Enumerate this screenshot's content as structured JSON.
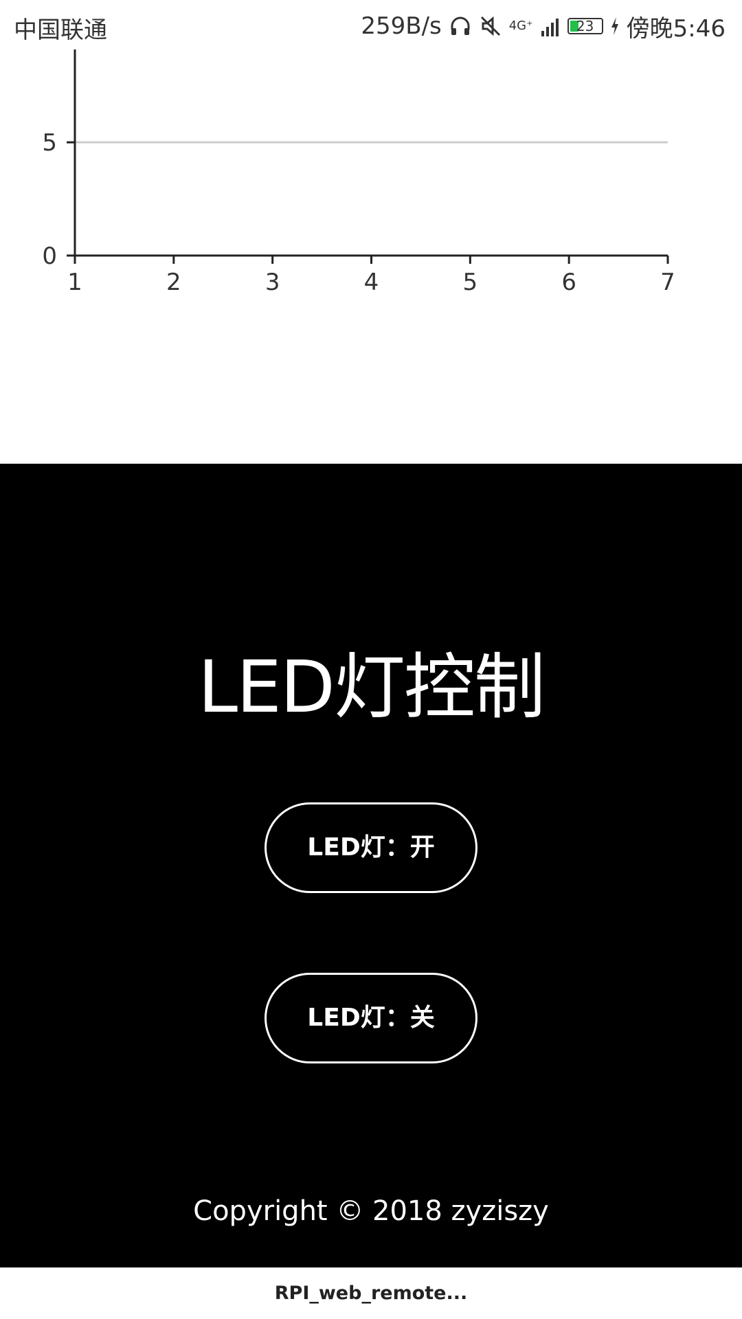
{
  "status_bar": {
    "carrier": "中国联通",
    "network_speed": "259B/s",
    "headphone_icon": "headphone-icon",
    "mute_icon": "mute-icon",
    "signal_label": "4G⁺",
    "signal_icon": "signal-icon",
    "battery_level": "23",
    "charging_icon": "charging-icon",
    "time": "傍晚5:46"
  },
  "chart_data": {
    "type": "line",
    "title": "",
    "xlabel": "",
    "ylabel": "",
    "x_ticks": [
      "1",
      "2",
      "3",
      "4",
      "5",
      "6",
      "7"
    ],
    "y_ticks": [
      "0",
      "5"
    ],
    "xlim": [
      1,
      7
    ],
    "ylim": [
      0,
      9.1
    ],
    "series": [],
    "grid": "horizontal at y=5"
  },
  "led_panel": {
    "title": "LED灯控制",
    "on_button": "LED灯：开",
    "off_button": "LED灯：关",
    "copyright": "Copyright © 2018 zyziszy"
  },
  "bottom_bar": {
    "page_title": "RPI_web_remote..."
  }
}
